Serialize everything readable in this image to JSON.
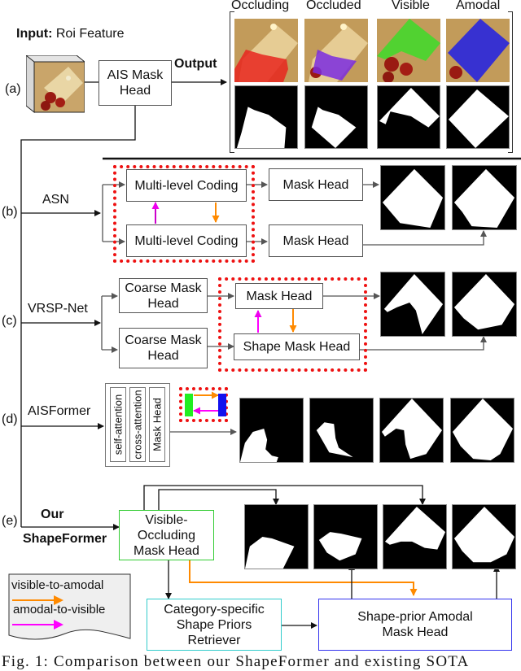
{
  "input": {
    "label_bold": "Input:",
    "label_rest": " Roi Feature"
  },
  "rows": {
    "a": {
      "tag": "(a)",
      "head": "AIS Mask Head",
      "output_label": "Output",
      "columns": [
        "Occluding",
        "Occluded",
        "Visible",
        "Amodal"
      ],
      "overlay_colors": [
        "#e8261e",
        "#7a2be0",
        "#3ddc2a",
        "#1f1fe6"
      ]
    },
    "b": {
      "tag": "(b)",
      "method": "ASN",
      "coding_top": "Multi-level Coding",
      "coding_bottom": "Multi-level Coding",
      "mask_head_top": "Mask Head",
      "mask_head_bottom": "Mask Head"
    },
    "c": {
      "tag": "(c)",
      "method": "VRSP-Net",
      "coarse_top": "Coarse Mask Head",
      "coarse_bottom": "Coarse Mask Head",
      "mask_head": "Mask Head",
      "shape_mask_head": "Shape Mask Head"
    },
    "d": {
      "tag": "(d)",
      "method": "AISFormer",
      "blocks": [
        "self-attention",
        "cross-attention",
        "Mask Head"
      ]
    },
    "e": {
      "tag": "(e)",
      "method_line1": "Our",
      "method_line2": "ShapeFormer",
      "vo_head": "Visible-Occluding Mask Head",
      "retriever": "Category-specific Shape Priors Retriever",
      "amodal_head": "Shape-prior Amodal Mask Head"
    }
  },
  "legend": {
    "items": [
      {
        "label": "visible-to-amodal",
        "color": "#ff8a00"
      },
      {
        "label": "amodal-to-visible",
        "color": "#ff00ff"
      }
    ]
  },
  "colors": {
    "highlight_dotted": "#ee1111",
    "visible_occluding_border": "#33cc33",
    "retriever_border": "#33cccc",
    "amodal_head_border": "#3333ee"
  },
  "caption": "Fig. 1: Comparison between our ShapeFormer and existing SOTA"
}
